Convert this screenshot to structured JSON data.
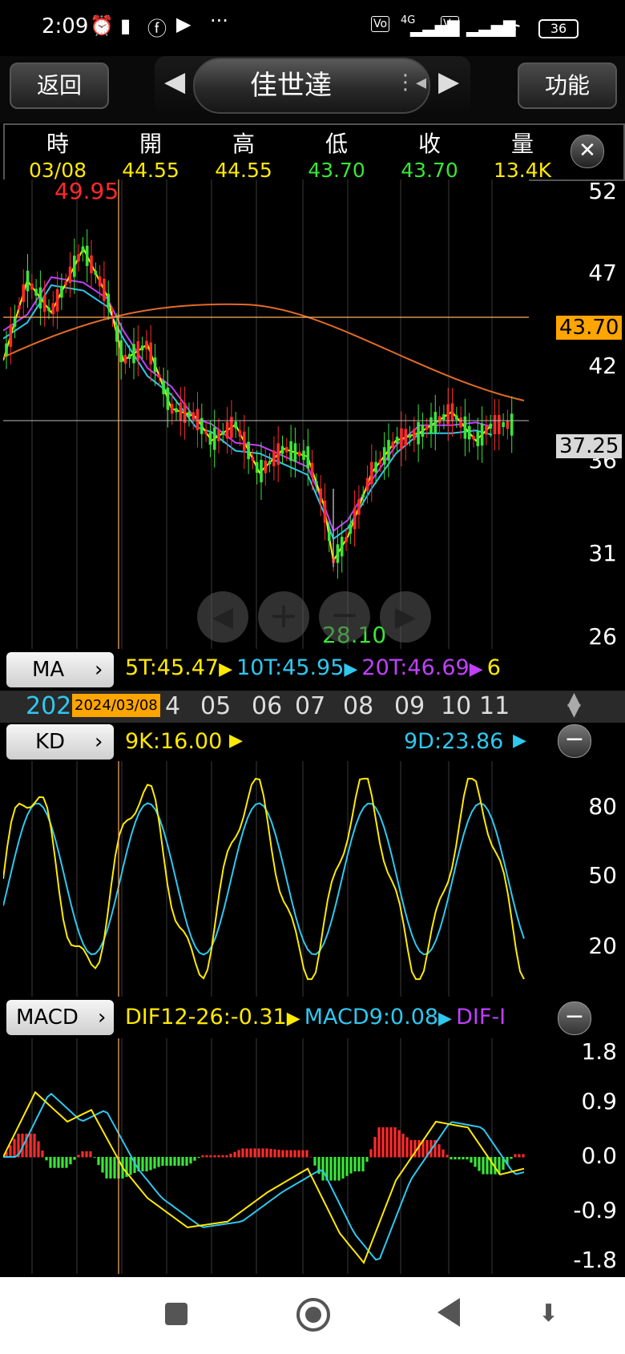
{
  "status_bar": {
    "time": "2:09",
    "battery": "36",
    "network": "4G"
  },
  "nav": {
    "back_label": "返回",
    "title": "佳世達",
    "function_label": "功能"
  },
  "price_header": {
    "columns": [
      {
        "label": "時",
        "value": "03/08",
        "color": "#ffea00"
      },
      {
        "label": "開",
        "value": "44.55",
        "color": "#ffea00"
      },
      {
        "label": "高",
        "value": "44.55",
        "color": "#ffea00"
      },
      {
        "label": "低",
        "value": "43.70",
        "color": "#39e639"
      },
      {
        "label": "收",
        "value": "43.70",
        "color": "#39e639"
      },
      {
        "label": "量",
        "value": "13.4K",
        "color": "#ffea00"
      }
    ],
    "close_icon": "close-icon"
  },
  "price_chart": {
    "y_labels": [
      "52",
      "47",
      "42",
      "36",
      "31",
      "26"
    ],
    "max_label": "49.95",
    "min_label": "28.10",
    "crosshair_price": "43.70",
    "last_price": "37.25",
    "zoom_controls": [
      "left-arrow-icon",
      "zoom-in-icon",
      "zoom-out-icon",
      "right-arrow-icon"
    ]
  },
  "ma": {
    "button_label": "MA",
    "legend": [
      {
        "text": "5T:45.47",
        "color": "#ffea00"
      },
      {
        "text": "10T:45.95",
        "color": "#2ec8f0"
      },
      {
        "text": "20T:46.69",
        "color": "#c040ff"
      },
      {
        "text": "6",
        "color": "#ffea00"
      }
    ]
  },
  "time_axis": {
    "year_prefix": "202",
    "selected_date": "2024/03/08",
    "months": [
      "4",
      "05",
      "06",
      "07",
      "08",
      "09",
      "10",
      "11"
    ]
  },
  "kd": {
    "button_label": "KD",
    "k_text": "9K:16.00",
    "d_text": "9D:23.86",
    "y_labels": [
      "80",
      "50",
      "20"
    ]
  },
  "macd": {
    "button_label": "MACD",
    "legend": [
      {
        "text": "DIF12-26:-0.31",
        "color": "#ffea00"
      },
      {
        "text": "MACD9:0.08",
        "color": "#2ec8f0"
      },
      {
        "text": "DIF-I",
        "color": "#c040ff"
      }
    ],
    "y_labels": [
      "1.8",
      "0.9",
      "0.0",
      "-0.9",
      "-1.8"
    ]
  },
  "bottom_nav": {
    "icons": [
      "recent-apps-icon",
      "home-icon",
      "back-icon",
      "notification-pull-icon"
    ]
  }
}
